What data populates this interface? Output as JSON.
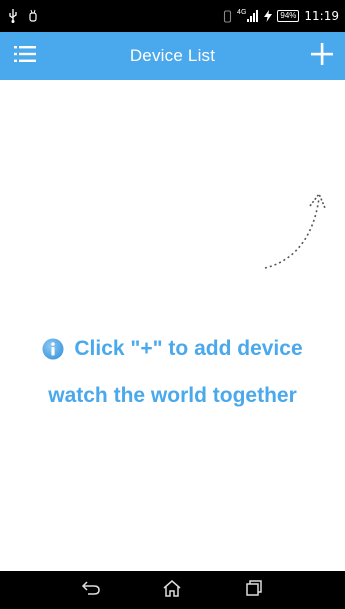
{
  "status_bar": {
    "network_badge": "4G",
    "battery_level": "94%",
    "time": "11:19",
    "icons": [
      "usb-icon",
      "android-debug-icon",
      "vibrate-icon",
      "signal-icon",
      "charging-icon",
      "battery-icon"
    ]
  },
  "header": {
    "title": "Device List",
    "menu_icon": "hamburger-menu-icon",
    "add_icon": "plus-icon"
  },
  "empty_state": {
    "line1": "Click \"+\" to add device",
    "line2": "watch the world together",
    "info_icon": "info-icon",
    "arrow_icon": "dotted-arrow-icon"
  },
  "nav_bar": {
    "icons": [
      "back-icon",
      "home-icon",
      "recent-apps-icon"
    ]
  },
  "colors": {
    "accent": "#4aa8ec",
    "status_bar": "#000000",
    "background": "#ffffff"
  }
}
